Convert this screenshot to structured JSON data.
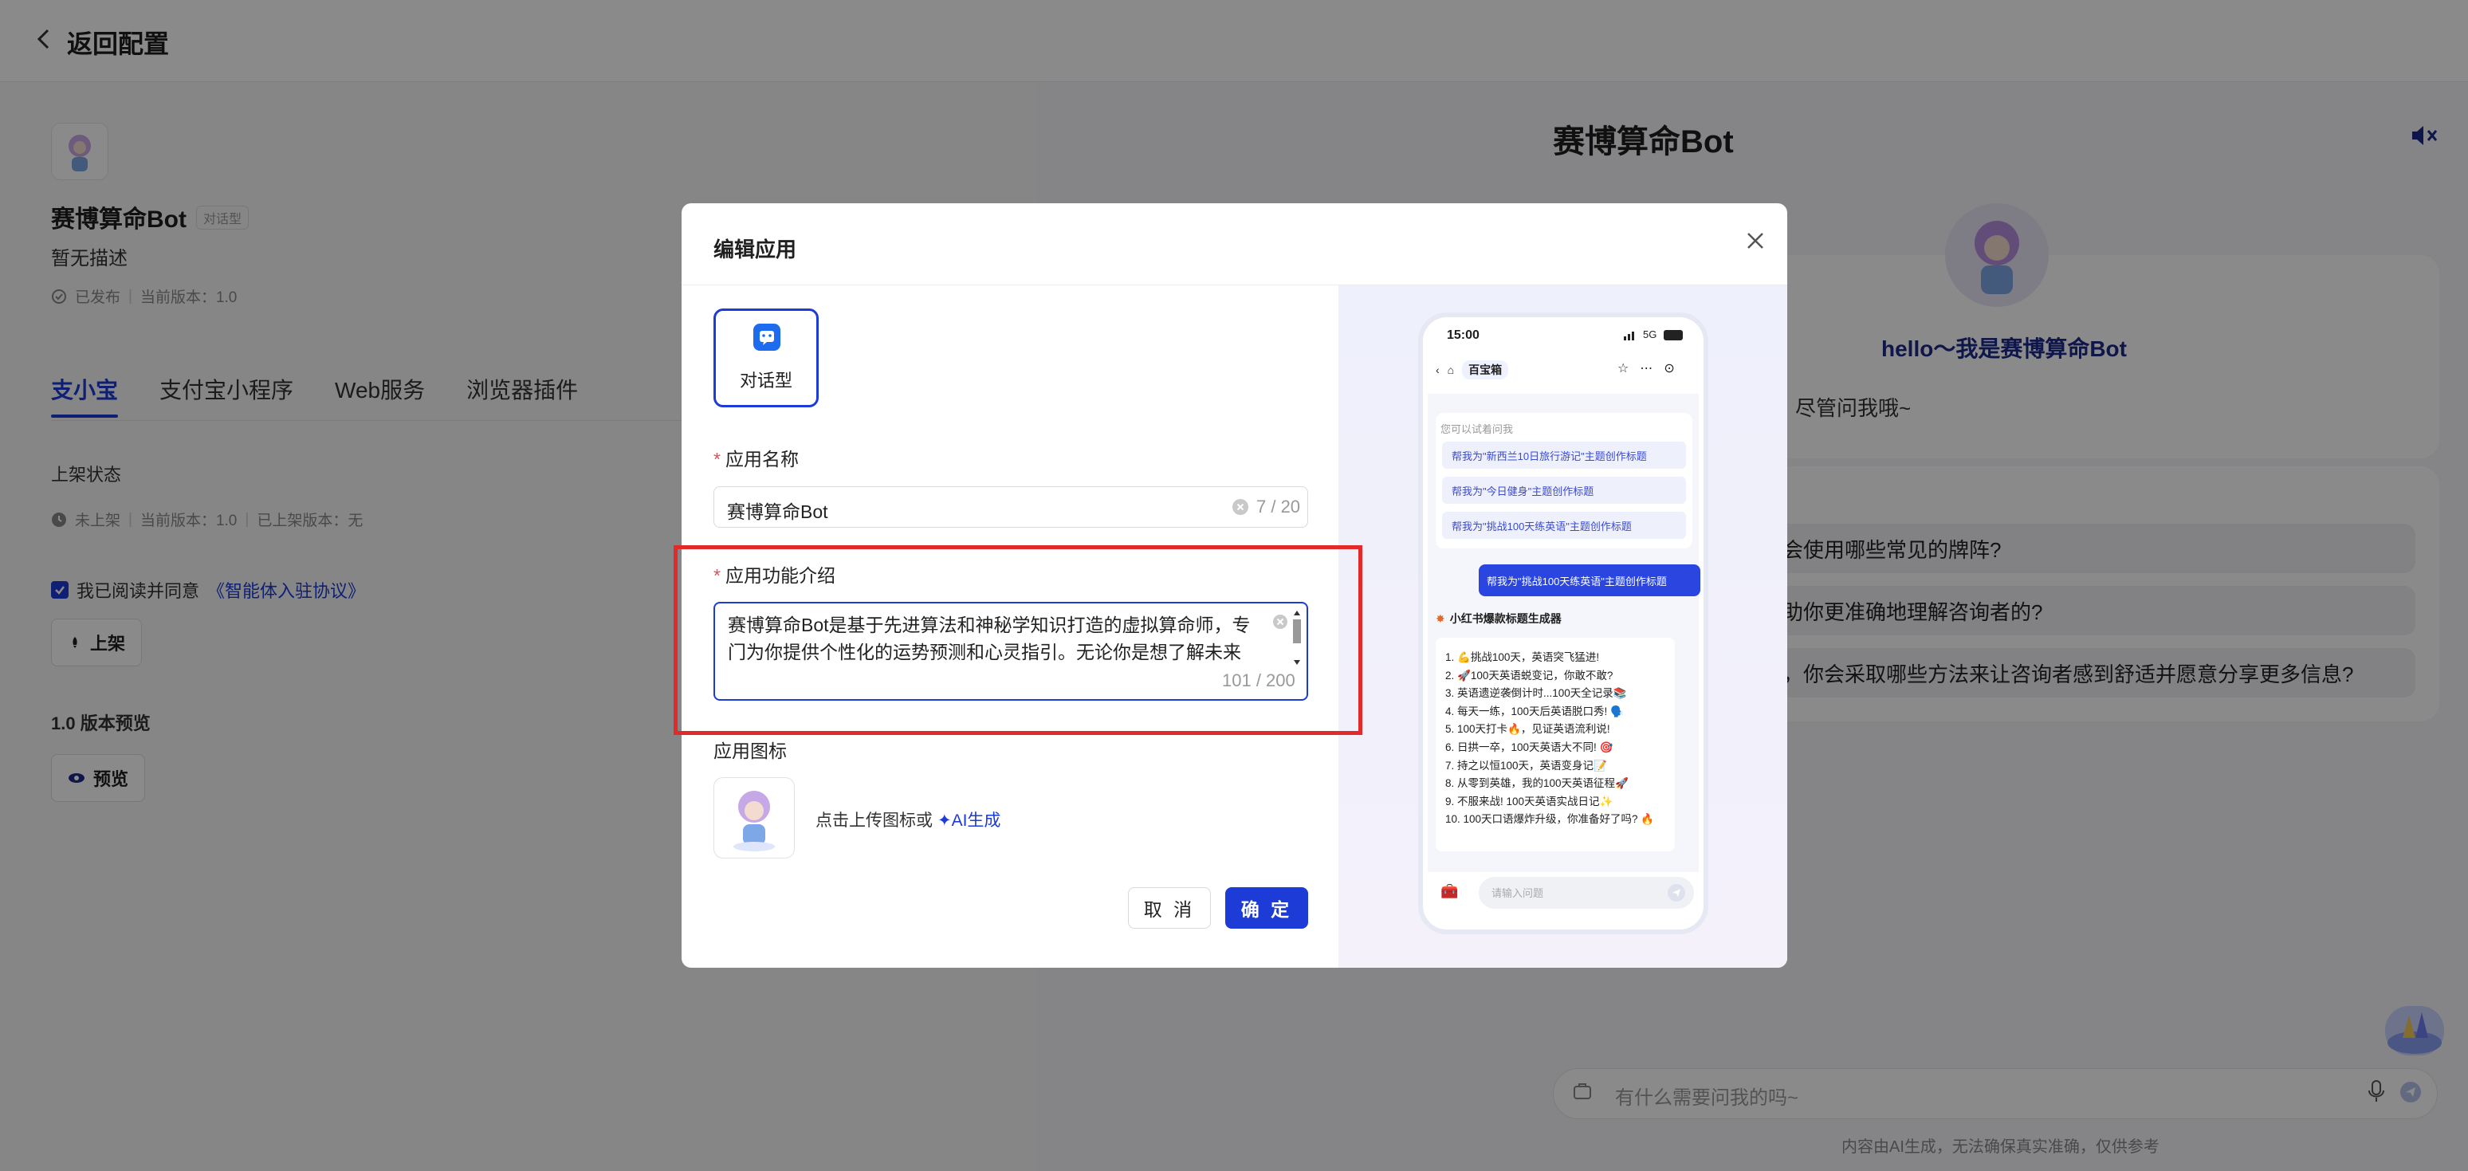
{
  "header": {
    "back_label": "返回配置"
  },
  "app": {
    "name": "赛博算命Bot",
    "type_tag": "对话型",
    "description": "暂无描述",
    "publish_status": "已发布",
    "current_version": "当前版本：1.0"
  },
  "tabs": [
    "支小宝",
    "支付宝小程序",
    "Web服务",
    "浏览器插件"
  ],
  "listing": {
    "title": "上架状态",
    "status": "未上架",
    "current_version": "当前版本：1.0",
    "listed_version": "已上架版本：无",
    "agree_prefix": "我已阅读并同意",
    "agree_link": "《智能体入驻协议》",
    "list_button": "上架",
    "preview_title": "1.0 版本预览",
    "preview_button": "预览"
  },
  "preview": {
    "bot_name": "赛博算命Bot",
    "hello": "hello～我是赛博算命Bot",
    "hello_sub": "吗，尽管问我哦~",
    "questions": [
      "你会使用哪些常见的牌阵?",
      "帮助你更准确地理解咨询者的?",
      "上，你会采取哪些方法来让咨询者感到舒适并愿意分享更多信息?"
    ],
    "input_placeholder": "有什么需要问我的吗~",
    "disclaimer": "内容由AI生成，无法确保真实准确，仅供参考"
  },
  "modal": {
    "title": "编辑应用",
    "type_label": "对话型",
    "name_label": "应用名称",
    "name_value": "赛博算命Bot",
    "name_count": "7 / 20",
    "desc_label": "应用功能介绍",
    "desc_value": "赛博算命Bot是基于先进算法和神秘学知识打造的虚拟算命师，专门为你提供个性化的运势预测和心灵指引。无论你是想了解未来趋",
    "desc_count": "101 / 200",
    "icon_label": "应用图标",
    "icon_hint": "点击上传图标或",
    "ai_gen": "✦AI生成",
    "cancel": "取 消",
    "ok": "确 定"
  },
  "phone": {
    "time": "15:00",
    "status": "5G",
    "nav_title": "百宝箱",
    "tip": "您可以试着问我",
    "chips": [
      "帮我为\"新西兰10日旅行游记\"主题创作标题",
      "帮我为\"今日健身\"主题创作标题",
      "帮我为\"挑战100天练英语\"主题创作标题"
    ],
    "user_msg": "帮我为\"挑战100天练英语\"主题创作标题",
    "bot_title": "小红书爆款标题生成器",
    "list": [
      "1. 💪挑战100天，英语突飞猛进!",
      "2. 🚀100天英语蜕变记，你敢不敢?",
      "3. 英语遗逆袭倒计时...100天全记录📚",
      "4. 每天一练，100天后英语脱口秀! 🗣️",
      "5. 100天打卡🔥，见证英语流利说!",
      "6. 日拱一卒，100天英语大不同! 🎯",
      "7. 持之以恒100天，英语变身记📝",
      "8. 从零到英雄，我的100天英语征程🚀",
      "9. 不服来战! 100天英语实战日记✨",
      "10. 100天口语爆炸升级，你准备好了吗? 🔥"
    ],
    "input_placeholder": "请输入问题"
  },
  "colors": {
    "accent": "#1d3bd6",
    "highlight": "#e32a2a"
  }
}
